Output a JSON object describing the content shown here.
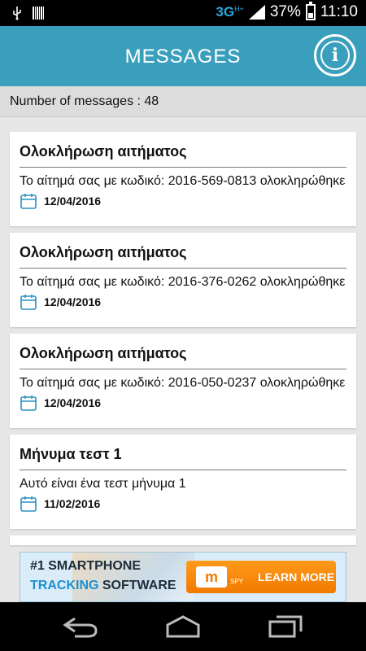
{
  "status_bar": {
    "network": "3G",
    "network_badge": "H+",
    "battery": "37%",
    "time": "11:10",
    "icons": [
      "usb-icon",
      "barcode-icon",
      "signal-icon",
      "battery-icon"
    ]
  },
  "header": {
    "title": "MESSAGES",
    "info_icon": "info-icon",
    "info_glyph": "i"
  },
  "count_label": "Number of messages : 48",
  "messages": [
    {
      "subject": "Ολοκλήρωση αιτήματος",
      "body": "Το αίτημά σας με κωδικό: 2016-569-0813 ολοκληρώθηκε",
      "date": "12/04/2016"
    },
    {
      "subject": "Ολοκλήρωση αιτήματος",
      "body": "Το αίτημά σας με κωδικό: 2016-376-0262 ολοκληρώθηκε",
      "date": "12/04/2016"
    },
    {
      "subject": "Ολοκλήρωση αιτήματος",
      "body": "Το αίτημά σας με κωδικό: 2016-050-0237 ολοκληρώθηκε",
      "date": "12/04/2016"
    },
    {
      "subject": "Μήνυμα τεστ 1",
      "body": "Αυτό είναι ένα τεστ μήνυμα 1",
      "date": "11/02/2016"
    }
  ],
  "ad": {
    "line1": "#1 SMARTPHONE",
    "line2_highlight": "TRACKING",
    "line2_rest": " SOFTWARE",
    "logo": "m",
    "logo_sub": "SPY",
    "cta": "LEARN MORE"
  },
  "nav": {
    "back_icon": "back-icon",
    "home_icon": "home-icon",
    "recents_icon": "recent-apps-icon"
  },
  "colors": {
    "header": "#3a9fbd",
    "calendar": "#2a8fc4",
    "cta": "#f07a00"
  }
}
